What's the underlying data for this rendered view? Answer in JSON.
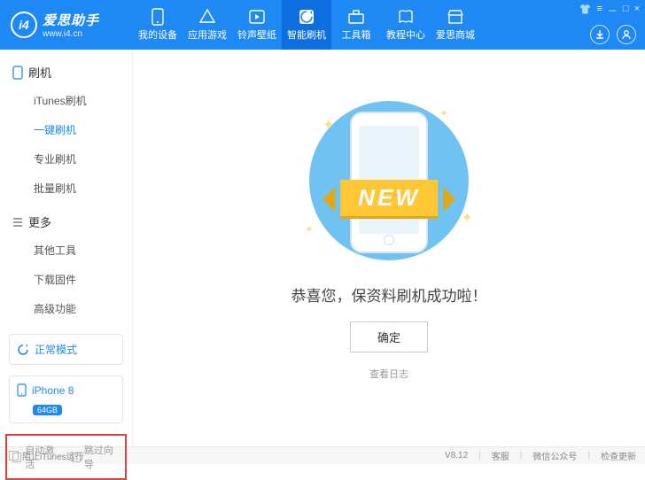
{
  "header": {
    "logo_main": "爱思助手",
    "logo_sub": "www.i4.cn",
    "logo_badge": "i4",
    "tabs": [
      {
        "label": "我的设备"
      },
      {
        "label": "应用游戏"
      },
      {
        "label": "铃声壁纸"
      },
      {
        "label": "智能刷机"
      },
      {
        "label": "工具箱"
      },
      {
        "label": "教程中心"
      },
      {
        "label": "爱思商城"
      }
    ]
  },
  "sidebar": {
    "section1": {
      "title": "刷机",
      "items": [
        "iTunes刷机",
        "一键刷机",
        "专业刷机",
        "批量刷机"
      ],
      "active_index": 1
    },
    "section2": {
      "title": "更多",
      "items": [
        "其他工具",
        "下载固件",
        "高级功能"
      ]
    },
    "mode": "正常模式",
    "device": {
      "name": "iPhone 8",
      "storage": "64GB"
    },
    "options": {
      "opt1": "自动激活",
      "opt2": "跳过向导"
    }
  },
  "content": {
    "ribbon": "NEW",
    "message": "恭喜您，保资料刷机成功啦！",
    "ok": "确定",
    "log": "查看日志"
  },
  "footer": {
    "block_itunes": "阻止iTunes运行",
    "version": "V8.12",
    "links": [
      "客服",
      "微信公众号",
      "检查更新"
    ]
  }
}
